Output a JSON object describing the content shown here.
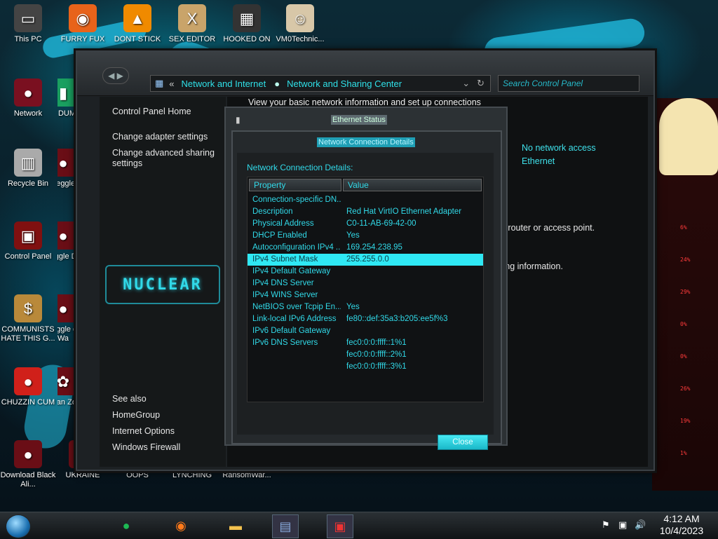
{
  "desktop": {
    "icons": [
      {
        "label": "This PC",
        "icon": "computer-icon"
      },
      {
        "label": "FURRY FUX",
        "icon": "firefox-icon"
      },
      {
        "label": "DONT STICK",
        "icon": "vlc-icon"
      },
      {
        "label": "SEX EDITOR",
        "icon": "hxd-editor-icon"
      },
      {
        "label": "HOOKED ON",
        "icon": "maze-app-icon"
      },
      {
        "label": "VM0Technic...",
        "icon": "doctor-icon"
      },
      {
        "label": "Network",
        "icon": "network-icon"
      },
      {
        "label": "Recycle Bin",
        "icon": "recycle-bin-icon"
      },
      {
        "label": "Control Panel",
        "icon": "control-panel-icon"
      },
      {
        "label": "COMMUNISTS HATE THIS G...",
        "icon": "money-bag-icon"
      },
      {
        "label": "CHUZZIN CUM",
        "icon": "chuzzle-icon"
      },
      {
        "label": "Download Black Ali...",
        "icon": "alien-icon"
      },
      {
        "label": "UKRAINE",
        "icon": "peggle-icon"
      },
      {
        "label": "OOPS",
        "icon": "oops-icon"
      },
      {
        "label": "LYNCHING",
        "icon": "lynching-icon"
      },
      {
        "label": "RansomWar...",
        "icon": "ransomware-icon"
      },
      {
        "label": "D DUM",
        "icon": "doc-icon"
      },
      {
        "label": "Peggle",
        "icon": "peggle-icon"
      },
      {
        "label": "Peggle De",
        "icon": "peggle-icon"
      },
      {
        "label": "Peggle of Wa",
        "icon": "peggle-icon"
      },
      {
        "label": "Plan Zo",
        "icon": "plants-zombies-icon"
      }
    ]
  },
  "control_panel": {
    "breadcrumb": [
      "Network and Internet",
      "Network and Sharing Center"
    ],
    "search_placeholder": "Search Control Panel",
    "sidebar": {
      "home": "Control Panel Home",
      "links": [
        "Change adapter settings",
        "Change advanced sharing settings"
      ],
      "logo_text": "NUCLEAR",
      "see_also_title": "See also",
      "see_also": [
        "HomeGroup",
        "Internet Options",
        "Windows Firewall"
      ]
    },
    "heading": "View your basic network information and set up connections",
    "access_type": "No network access",
    "connection": "Ethernet",
    "fragment_1": "a router or access point.",
    "fragment_2": "ting information."
  },
  "ethernet_status": {
    "title": "Ethernet Status"
  },
  "details_dialog": {
    "title": "Network Connection Details",
    "caption": "Network Connection Details:",
    "columns": [
      "Property",
      "Value"
    ],
    "rows": [
      {
        "property": "Connection-specific DN...",
        "value": ""
      },
      {
        "property": "Description",
        "value": "Red Hat VirtIO Ethernet Adapter"
      },
      {
        "property": "Physical Address",
        "value": "C0-11-AB-69-42-00"
      },
      {
        "property": "DHCP Enabled",
        "value": "Yes"
      },
      {
        "property": "Autoconfiguration IPv4 ...",
        "value": "169.254.238.95"
      },
      {
        "property": "IPv4 Subnet Mask",
        "value": "255.255.0.0",
        "selected": true
      },
      {
        "property": "IPv4 Default Gateway",
        "value": ""
      },
      {
        "property": "IPv4 DNS Server",
        "value": ""
      },
      {
        "property": "IPv4 WINS Server",
        "value": ""
      },
      {
        "property": "NetBIOS over Tcpip En...",
        "value": "Yes"
      },
      {
        "property": "Link-local IPv6 Address",
        "value": "fe80::def:35a3:b205:ee5f%3"
      },
      {
        "property": "IPv6 Default Gateway",
        "value": ""
      },
      {
        "property": "IPv6 DNS Servers",
        "value": "fec0:0:0:ffff::1%1"
      },
      {
        "property": "",
        "value": "fec0:0:0:ffff::2%1"
      },
      {
        "property": "",
        "value": "fec0:0:0:ffff::3%1"
      }
    ],
    "close_label": "Close"
  },
  "taskbar": {
    "apps": [
      "spotify-icon",
      "firefox-icon",
      "file-explorer-icon",
      "control-panel-icon",
      "network-details-icon"
    ],
    "clock_time": "4:12 AM",
    "clock_date": "10/4/2023"
  },
  "deco_numbers": [
    "6%",
    "24%",
    "29%",
    "0%",
    "0%",
    "26%",
    "19%",
    "1%"
  ],
  "colors": {
    "accent": "#2fe0e8",
    "selection": "#2fe8f4"
  }
}
